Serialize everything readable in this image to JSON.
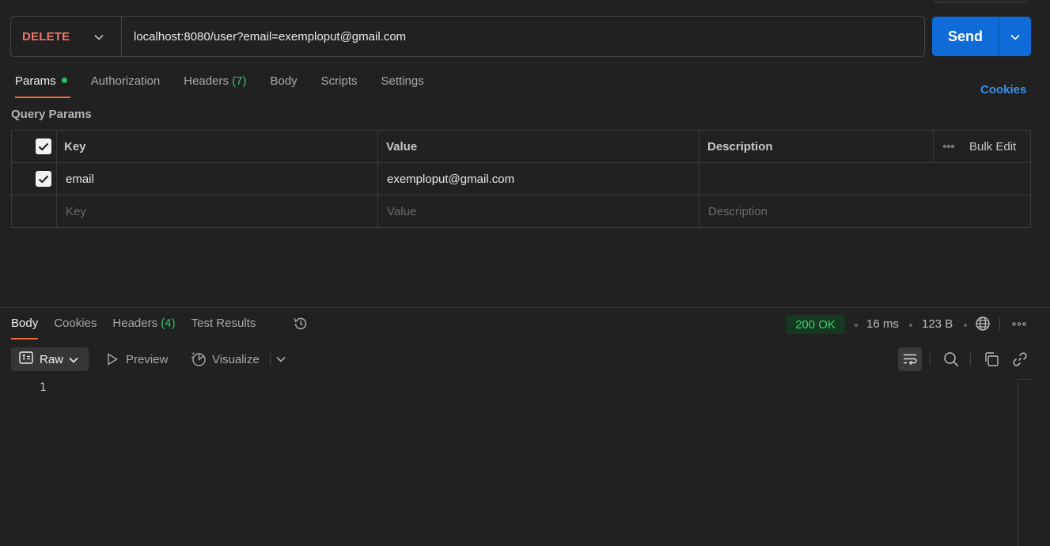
{
  "request": {
    "method": "DELETE",
    "url": "localhost:8080/user?email=exemploput@gmail.com",
    "send_label": "Send"
  },
  "request_tabs": {
    "params": "Params",
    "authorization": "Authorization",
    "headers": "Headers",
    "headers_count": "(7)",
    "body": "Body",
    "scripts": "Scripts",
    "settings": "Settings",
    "cookies": "Cookies"
  },
  "query_params": {
    "title": "Query Params",
    "columns": {
      "key": "Key",
      "value": "Value",
      "description": "Description"
    },
    "bulk_edit": "Bulk Edit",
    "rows": [
      {
        "checked": true,
        "key": "email",
        "value": "exemploput@gmail.com",
        "description": ""
      }
    ],
    "placeholders": {
      "key": "Key",
      "value": "Value",
      "description": "Description"
    }
  },
  "response_tabs": {
    "body": "Body",
    "cookies": "Cookies",
    "headers": "Headers",
    "headers_count": "(4)",
    "test_results": "Test Results"
  },
  "response_meta": {
    "status": "200 OK",
    "time": "16 ms",
    "size": "123 B"
  },
  "response_toolbar": {
    "raw": "Raw",
    "preview": "Preview",
    "visualize": "Visualize"
  },
  "response_body": {
    "line_numbers": [
      "1"
    ]
  },
  "colors": {
    "background": "#212121",
    "method_delete": "#f0766a",
    "send_button": "#0e6bd8",
    "accent_tab": "#f26b3a",
    "status_ok": "#3fcf6f",
    "link": "#3d8fe6"
  }
}
